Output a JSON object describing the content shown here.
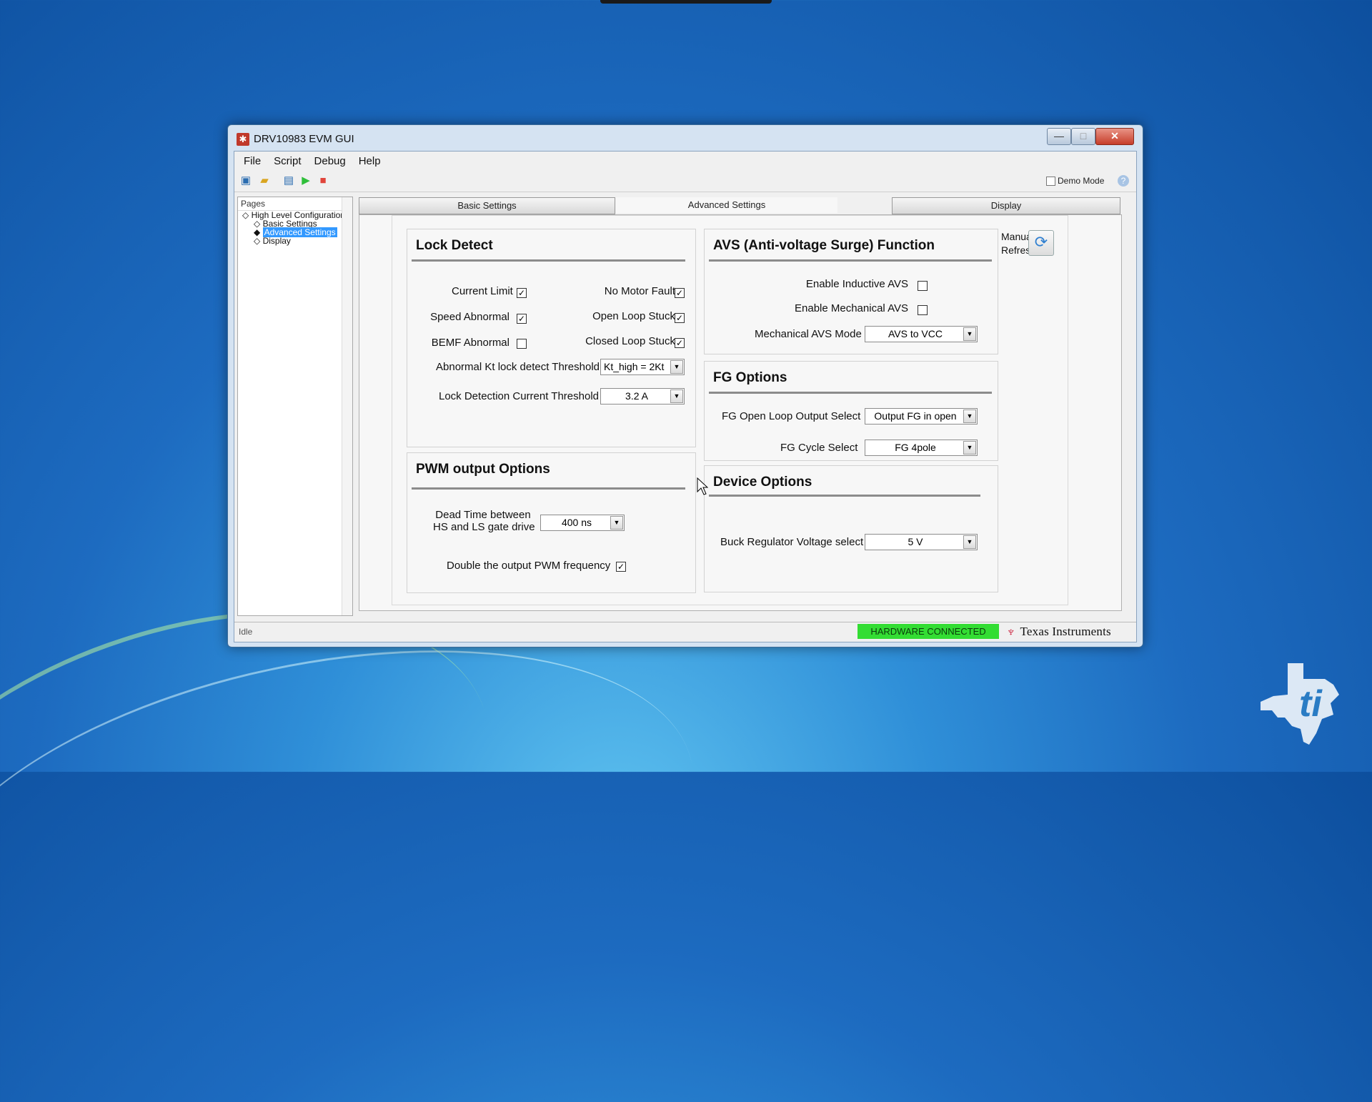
{
  "window": {
    "title": "DRV10983 EVM GUI"
  },
  "menu": [
    "File",
    "Script",
    "Debug",
    "Help"
  ],
  "toolbar": {
    "demo_mode_label": "Demo Mode"
  },
  "pages": {
    "header": "Pages",
    "items": [
      "High Level Configuration",
      "Basic Settings",
      "Advanced Settings",
      "Display"
    ]
  },
  "tabs": [
    "Basic Settings",
    "Advanced Settings",
    "Display"
  ],
  "lock_detect": {
    "title": "Lock Detect",
    "current_limit": {
      "label": "Current Limit",
      "checked": true
    },
    "no_motor_fault": {
      "label": "No Motor Fault",
      "checked": true
    },
    "speed_abnormal": {
      "label": "Speed Abnormal",
      "checked": true
    },
    "open_loop_stuck": {
      "label": "Open Loop Stuck",
      "checked": true
    },
    "bemf_abnormal": {
      "label": "BEMF Abnormal",
      "checked": false
    },
    "closed_loop_stuck": {
      "label": "Closed Loop Stuck",
      "checked": true
    },
    "kt_threshold": {
      "label": "Abnormal Kt lock detect Threshold",
      "value": "Kt_high = 2Kt"
    },
    "current_threshold": {
      "label": "Lock Detection Current Threshold",
      "value": "3.2 A"
    }
  },
  "pwm": {
    "title": "PWM output Options",
    "dead_time": {
      "label_line1": "Dead Time between",
      "label_line2": "HS and LS gate drive",
      "value": "400 ns"
    },
    "double_freq": {
      "label": "Double the output PWM frequency",
      "checked": true
    }
  },
  "avs": {
    "title": "AVS (Anti-voltage Surge) Function",
    "inductive": {
      "label": "Enable Inductive AVS",
      "checked": false
    },
    "mechanical": {
      "label": "Enable Mechanical AVS",
      "checked": false
    },
    "mode": {
      "label": "Mechanical AVS Mode",
      "value": "AVS to VCC"
    }
  },
  "fg": {
    "title": "FG Options",
    "open_loop": {
      "label": "FG Open Loop Output Select",
      "value": "Output FG in open"
    },
    "cycle": {
      "label": "FG Cycle Select",
      "value": "FG 4pole"
    }
  },
  "device": {
    "title": "Device Options",
    "buck": {
      "label": "Buck Regulator Voltage select",
      "value": "5 V"
    }
  },
  "refresh": {
    "line1": "Manual",
    "line2": "Refresh"
  },
  "status": {
    "state": "Idle",
    "hardware": "HARDWARE CONNECTED",
    "brand": "Texas Instruments"
  },
  "colors": {
    "hardware_ok": "#33dd33",
    "selection": "#3399ff",
    "ti_red": "#c8102e"
  }
}
